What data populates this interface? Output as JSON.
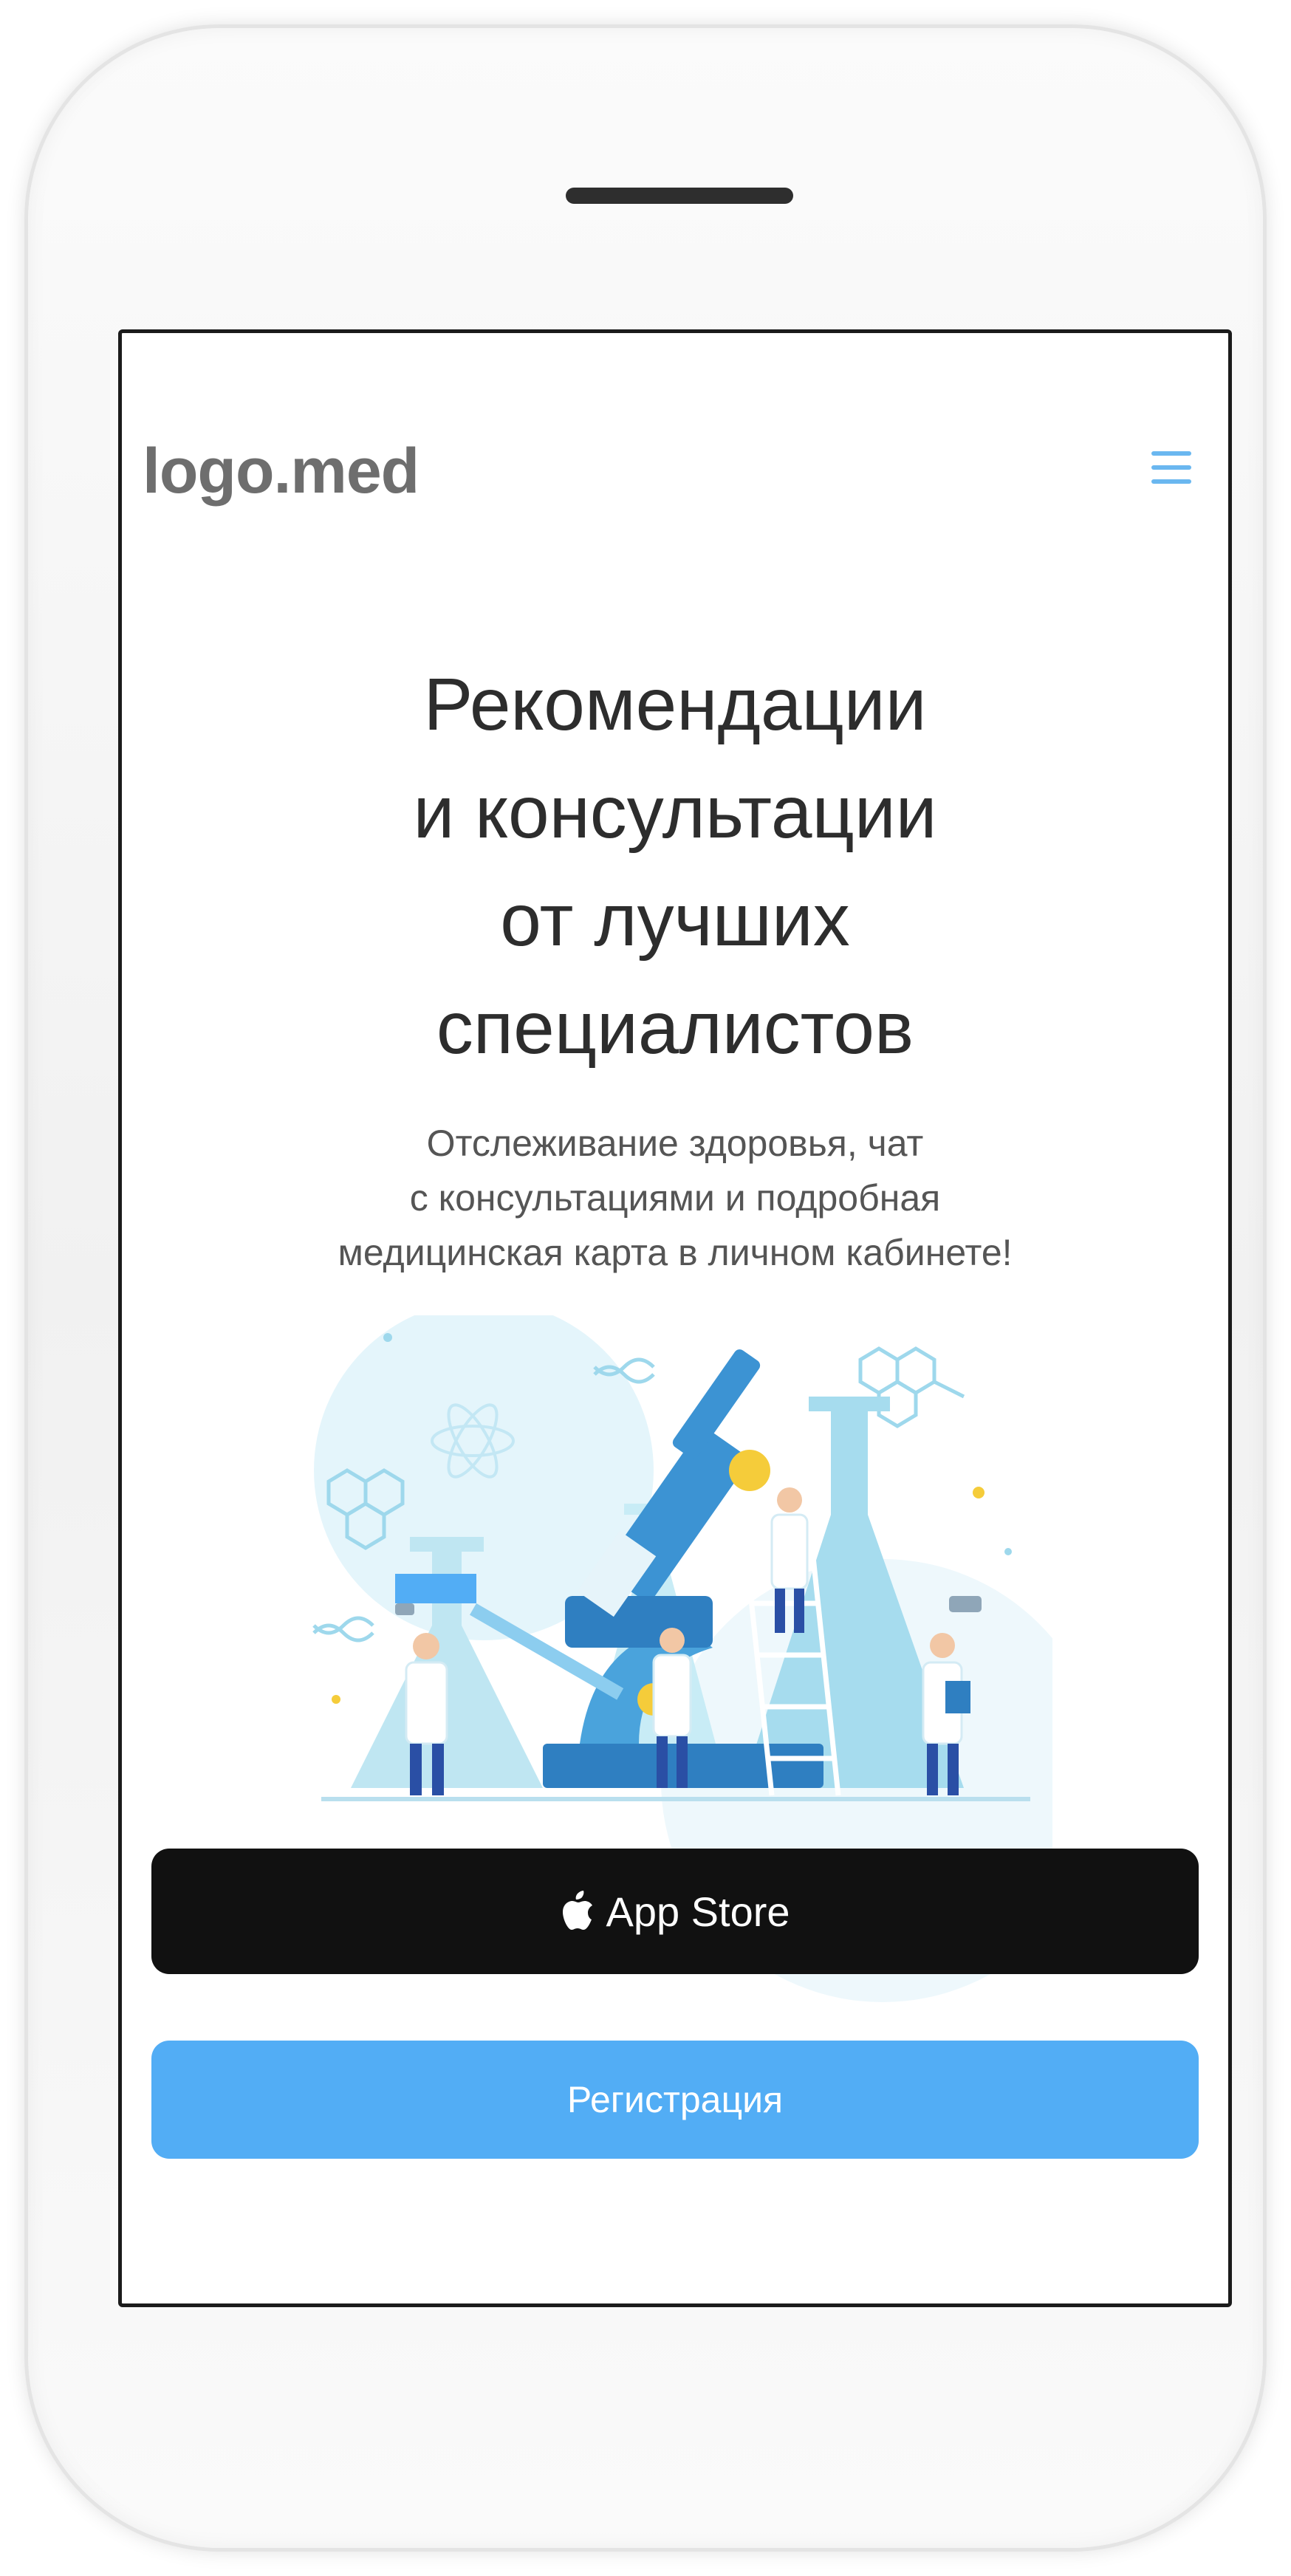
{
  "header": {
    "logo_text": "logo.med",
    "menu_icon": "hamburger-menu-icon"
  },
  "hero": {
    "title_lines": [
      "Рекомендации",
      "и консультации",
      "от лучших",
      "специалистов"
    ],
    "subtitle_lines": [
      "Отслеживание здоровья, чат",
      "с консультациями и подробная",
      "медицинская карта в личном кабинете!"
    ]
  },
  "illustration": {
    "icon": "laboratory-scientists-illustration"
  },
  "buttons": {
    "app_store_label": "App Store",
    "app_store_icon": "apple-logo-icon",
    "register_label": "Регистрация"
  },
  "colors": {
    "accent": "#52adf5",
    "menu_icon": "#6ab7f0",
    "app_store_button": "#111111",
    "title_text": "#2d2d2d",
    "logo_text": "#6e6e6e"
  }
}
